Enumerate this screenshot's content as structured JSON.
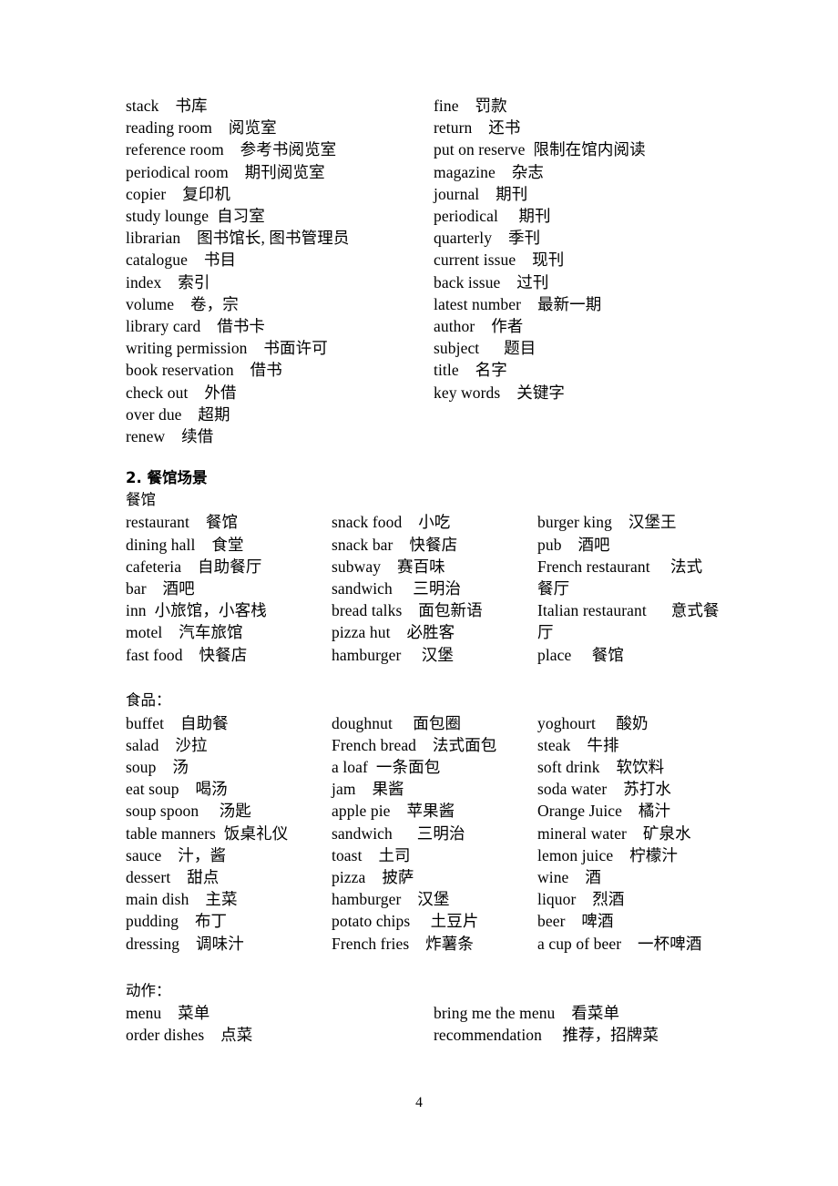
{
  "document": {
    "page_number": "4"
  },
  "library_section": {
    "left_column": [
      "stack    书库",
      "reading room    阅览室",
      "reference room    参考书阅览室",
      "periodical room    期刊阅览室",
      "copier    复印机",
      "study lounge  自习室",
      "librarian    图书馆长, 图书管理员",
      "catalogue    书目",
      "index    索引",
      "volume    卷，宗",
      "library card    借书卡",
      "writing permission    书面许可",
      "book reservation    借书",
      "check out    外借",
      "over due    超期",
      "renew    续借"
    ],
    "right_column": [
      "fine    罚款",
      "return    还书",
      "put on reserve  限制在馆内阅读",
      "magazine    杂志",
      "journal    期刊",
      "periodical     期刊",
      "quarterly    季刊",
      "current issue    现刊",
      "back issue    过刊",
      "latest number    最新一期",
      "author    作者",
      "subject      题目",
      "title    名字",
      "key words    关键字"
    ]
  },
  "restaurant_section": {
    "heading": "2. 餐馆场景",
    "subheading": "餐馆",
    "column1": [
      "restaurant    餐馆",
      "dining hall    食堂",
      "cafeteria    自助餐厅",
      "bar    酒吧",
      "inn  小旅馆，小客栈",
      "motel    汽车旅馆",
      "fast food    快餐店"
    ],
    "column2": [
      "snack food    小吃",
      "snack bar    快餐店",
      "subway    赛百味",
      "sandwich     三明治",
      "bread talks    面包新语",
      "pizza hut    必胜客",
      "hamburger     汉堡"
    ],
    "column3": [
      "burger king    汉堡王",
      "pub    酒吧",
      "French restaurant     法式",
      "餐厅",
      "Italian restaurant      意式餐",
      "厅",
      "place     餐馆"
    ]
  },
  "food_section": {
    "subheading": "食品：",
    "column1": [
      "buffet    自助餐",
      "salad    沙拉",
      "soup    汤",
      "eat soup    喝汤",
      "soup spoon     汤匙",
      "table manners  饭桌礼仪",
      "sauce    汁，酱",
      "dessert    甜点",
      "main dish    主菜",
      "pudding    布丁",
      "dressing    调味汁"
    ],
    "column2": [
      "doughnut     面包圈",
      "French bread    法式面包",
      "a loaf  一条面包",
      "jam    果酱",
      "apple pie    苹果酱",
      "sandwich      三明治",
      "toast    土司",
      "pizza    披萨",
      "hamburger    汉堡",
      "potato chips     土豆片",
      "French fries    炸薯条"
    ],
    "column3": [
      "yoghourt     酸奶",
      "steak    牛排",
      "soft drink    软饮料",
      "soda water    苏打水",
      "Orange Juice    橘汁",
      "mineral water    矿泉水",
      "lemon juice    柠檬汁",
      "wine    酒",
      "liquor    烈酒",
      "beer    啤酒",
      "a cup of beer    一杯啤酒"
    ]
  },
  "action_section": {
    "subheading": "动作：",
    "column1": [
      "menu    菜单",
      "order dishes    点菜"
    ],
    "column2": [
      "bring me the menu    看菜单",
      "recommendation     推荐，招牌菜"
    ]
  }
}
